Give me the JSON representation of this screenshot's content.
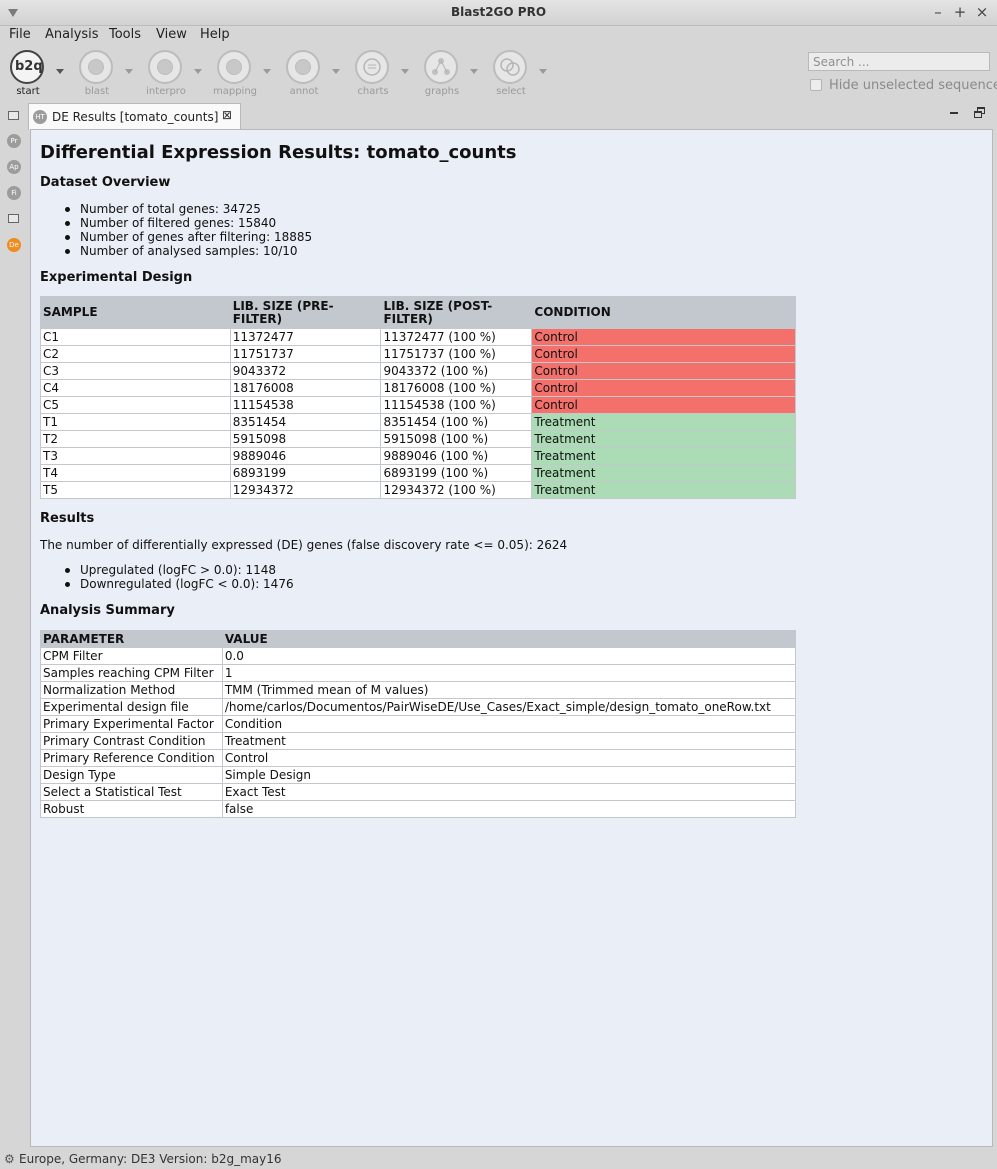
{
  "window": {
    "title": "Blast2GO PRO",
    "controls": [
      "–",
      "+",
      "×"
    ]
  },
  "menu": [
    "File",
    "Analysis",
    "Tools",
    "View",
    "Help"
  ],
  "toolbar": {
    "tools": [
      "start",
      "blast",
      "interpro",
      "mapping",
      "annot",
      "charts",
      "graphs",
      "select"
    ],
    "start_glyph": "b2q",
    "search_placeholder": "Search ...",
    "hide_label": "Hide unselected sequences"
  },
  "sidebar": {
    "icons": [
      "Pr",
      "Ap",
      "Fi",
      "De"
    ]
  },
  "tab": {
    "icon": "HT",
    "label": "DE Results [tomato_counts]",
    "close": "⊠"
  },
  "doc": {
    "title": "Differential Expression Results: tomato_counts",
    "overview_heading": "Dataset Overview",
    "overview": [
      "Number of total genes: 34725",
      "Number of filtered genes: 15840",
      "Number of genes after filtering: 18885",
      "Number of analysed samples: 10/10"
    ],
    "design_heading": "Experimental Design",
    "design_headers": [
      "SAMPLE",
      "LIB. SIZE (PRE-FILTER)",
      "LIB. SIZE (POST-FILTER)",
      "CONDITION"
    ],
    "design_rows": [
      [
        "C1",
        "11372477",
        "11372477 (100 %)",
        "Control"
      ],
      [
        "C2",
        "11751737",
        "11751737 (100 %)",
        "Control"
      ],
      [
        "C3",
        "9043372",
        "9043372 (100 %)",
        "Control"
      ],
      [
        "C4",
        "18176008",
        "18176008 (100 %)",
        "Control"
      ],
      [
        "C5",
        "11154538",
        "11154538 (100 %)",
        "Control"
      ],
      [
        "T1",
        "8351454",
        "8351454 (100 %)",
        "Treatment"
      ],
      [
        "T2",
        "5915098",
        "5915098 (100 %)",
        "Treatment"
      ],
      [
        "T3",
        "9889046",
        "9889046 (100 %)",
        "Treatment"
      ],
      [
        "T4",
        "6893199",
        "6893199 (100 %)",
        "Treatment"
      ],
      [
        "T5",
        "12934372",
        "12934372 (100 %)",
        "Treatment"
      ]
    ],
    "results_heading": "Results",
    "results_text": "The number of differentially expressed (DE) genes (false discovery rate <= 0.05): 2624",
    "results_list": [
      "Upregulated (logFC > 0.0): 1148",
      "Downregulated (logFC < 0.0): 1476"
    ],
    "summary_heading": "Analysis Summary",
    "summary_headers": [
      "PARAMETER",
      "VALUE"
    ],
    "summary_rows": [
      [
        "CPM Filter",
        "0.0"
      ],
      [
        "Samples reaching CPM Filter",
        "1"
      ],
      [
        "Normalization Method",
        "TMM (Trimmed mean of M values)"
      ],
      [
        "Experimental design file",
        "/home/carlos/Documentos/PairWiseDE/Use_Cases/Exact_simple/design_tomato_oneRow.txt"
      ],
      [
        "Primary Experimental Factor",
        "Condition"
      ],
      [
        "Primary Contrast Condition",
        "Treatment"
      ],
      [
        "Primary Reference Condition",
        "Control"
      ],
      [
        "Design Type",
        "Simple Design"
      ],
      [
        "Select a Statistical Test",
        "Exact Test"
      ],
      [
        "Robust",
        "false"
      ]
    ]
  },
  "status": {
    "text": "Europe, Germany: DE3 Version: b2g_may16"
  },
  "colors": {
    "control": "#f4716b",
    "treatment": "#acdcb6",
    "table_header": "#c3c8ce",
    "content_bg": "#eaeef6",
    "active_perspective": "#f08c1e"
  }
}
